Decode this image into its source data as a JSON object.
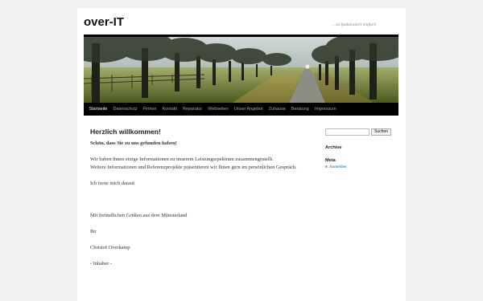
{
  "site": {
    "title": "over-IT",
    "tagline": "…es funktioniert einfach"
  },
  "nav": {
    "items": [
      "Startseite",
      "Datenschutz",
      "Firmen",
      "Kontakt",
      "Reparatur",
      "Webseiten",
      "Unser Angebot",
      "Zuhause",
      "Beratung",
      "Impressum"
    ],
    "active_index": 0
  },
  "content": {
    "title": "Herzlich willkommen!",
    "lead": "Schön, dass Sie zu uns gefunden haben!",
    "p1_line1": "Wir haben ihnen einige Informationen zu unserem Leistungsspektrum zusammengestellt.",
    "p1_line2": "Weitere Informationen und Referenzprojekte präsentieren wir Ihnen gern im persönlichen Gespräch.",
    "p2": "Ich freue mich darauf",
    "p3": "Mit freundlichen Grüßen aus dem Münsterland",
    "p4": "Ihr",
    "p5": "Christof Overkamp",
    "p6": "- Inhaber -"
  },
  "sidebar": {
    "search": {
      "value": "",
      "button_label": "Suchen"
    },
    "archive_title": "Archive",
    "meta_title": "Meta",
    "meta_links": [
      "Anmelden"
    ]
  },
  "colors": {
    "nav_background": "#000000",
    "link": "#1b60a0",
    "page_background": "#f1f1f1"
  },
  "icons": [
    "bullet-icon"
  ]
}
